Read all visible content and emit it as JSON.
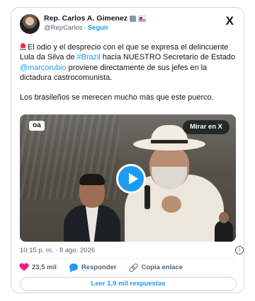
{
  "author": {
    "display_name": "Rep. Carlos A. Gimenez",
    "handle": "@RepCarlos",
    "separator": "·",
    "follow_label": "Seguir"
  },
  "platform_logo": "X",
  "tweet": {
    "p1_segments": [
      {
        "text": "El odio y el desprecio con el que se expresa el delincuente Lula da Silva de ",
        "type": "text"
      },
      {
        "text": "#Brazil",
        "type": "link"
      },
      {
        "text": " hacia NUESTRO Secretario de Estado ",
        "type": "text"
      },
      {
        "text": "@marcorubio",
        "type": "link"
      },
      {
        "text": " proviene directamente de sus jefes en la dictadura castrocomunista.",
        "type": "text"
      }
    ],
    "p2": "Los brasileños se merecen mucho más que este puerco."
  },
  "media": {
    "watermark": "oa",
    "view_on_x_label": "Mirar en X"
  },
  "meta": {
    "timestamp": "10:15 p. m. · 8 ago. 2026",
    "info_glyph": "i"
  },
  "actions": {
    "likes": "23,5 mil",
    "reply_label": "Responder",
    "copy_link_label": "Copia enlace"
  },
  "read_replies_label": "Leer 1,9 mil respuestas",
  "icons": {
    "siren": "police-light-emoji",
    "like": "heart-icon",
    "reply": "speech-bubble-icon",
    "copy": "link-icon",
    "verified": "gray-check-badge-icon",
    "flag": "us-flag-icon",
    "play": "play-icon",
    "info": "info-icon"
  },
  "colors": {
    "link": "#1d9bf0",
    "like": "#f91880",
    "muted": "#536471",
    "border": "#cfd9de"
  }
}
